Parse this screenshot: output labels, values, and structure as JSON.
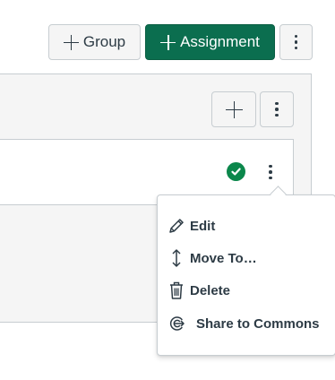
{
  "toolbar": {
    "group_label": "Group",
    "assignment_label": "Assignment"
  },
  "colors": {
    "primary_button": "#0b6e4f",
    "published_check": "#0b874b",
    "text": "#2d3b45",
    "panel_bg": "#f5f5f5",
    "border": "#c7cdd1"
  },
  "icons": {
    "group_button": "plus-icon",
    "assignment_button": "plus-icon",
    "toolbar_more": "kebab-icon",
    "group_add": "plus-icon",
    "group_more": "kebab-icon",
    "row_status": "check-circle-icon",
    "row_more": "kebab-icon"
  },
  "menu": {
    "items": [
      {
        "label": "Edit",
        "icon": "pencil-icon"
      },
      {
        "label": "Move To…",
        "icon": "move-arrows-icon"
      },
      {
        "label": "Delete",
        "icon": "trash-icon"
      },
      {
        "label": "Share to Commons",
        "icon": "commons-share-icon"
      }
    ]
  }
}
